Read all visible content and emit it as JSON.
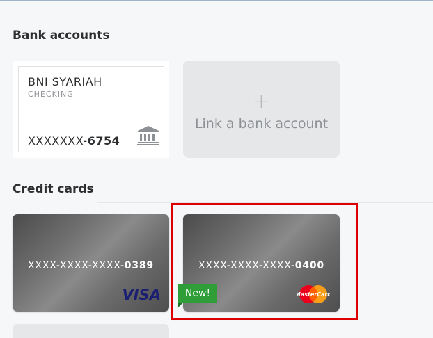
{
  "bank_section": {
    "title": "Bank accounts",
    "account": {
      "name": "BNI SYARIAH",
      "type": "CHECKING",
      "number_mask": "XXXXXXX-",
      "last4": "6754",
      "icon": "bank-building-icon"
    },
    "link_button": {
      "plus": "+",
      "label": "Link a bank account"
    }
  },
  "credit_section": {
    "title": "Credit cards",
    "cards": [
      {
        "number_mask": "XXXX-XXXX-XXXX-",
        "last4": "0389",
        "brand": "VISA"
      },
      {
        "number_mask": "XXXX-XXXX-XXXX-",
        "last4": "0400",
        "brand": "MasterCard",
        "badge": "New!"
      }
    ]
  },
  "colors": {
    "highlight": "#dc0000",
    "new_badge": "#2f9e39",
    "visa": "#1a1f71"
  }
}
